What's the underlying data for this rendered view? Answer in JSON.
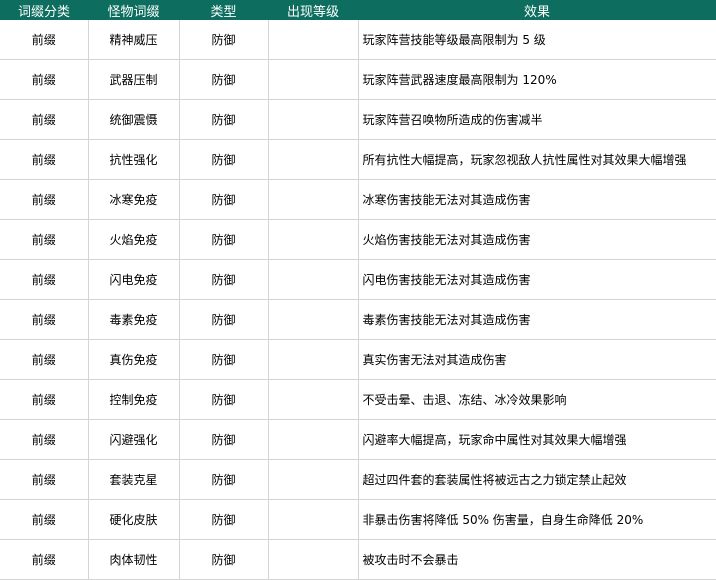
{
  "header": {
    "colors": {
      "header_bg": "#0d6e5f"
    },
    "columns": [
      "词缀分类",
      "怪物词缀",
      "类型",
      "出现等级",
      "效果"
    ]
  },
  "rows": [
    {
      "category": "前缀",
      "name": "精神威压",
      "type": "防御",
      "level": "",
      "effect": "玩家阵营技能等级最高限制为 5 级"
    },
    {
      "category": "前缀",
      "name": "武器压制",
      "type": "防御",
      "level": "",
      "effect": "玩家阵营武器速度最高限制为 120%"
    },
    {
      "category": "前缀",
      "name": "统御震慑",
      "type": "防御",
      "level": "",
      "effect": "玩家阵营召唤物所造成的伤害减半"
    },
    {
      "category": "前缀",
      "name": "抗性强化",
      "type": "防御",
      "level": "",
      "effect": "所有抗性大幅提高，玩家忽视敌人抗性属性对其效果大幅增强"
    },
    {
      "category": "前缀",
      "name": "冰寒免疫",
      "type": "防御",
      "level": "",
      "effect": "冰寒伤害技能无法对其造成伤害"
    },
    {
      "category": "前缀",
      "name": "火焰免疫",
      "type": "防御",
      "level": "",
      "effect": "火焰伤害技能无法对其造成伤害"
    },
    {
      "category": "前缀",
      "name": "闪电免疫",
      "type": "防御",
      "level": "",
      "effect": "闪电伤害技能无法对其造成伤害"
    },
    {
      "category": "前缀",
      "name": "毒素免疫",
      "type": "防御",
      "level": "",
      "effect": "毒素伤害技能无法对其造成伤害"
    },
    {
      "category": "前缀",
      "name": "真伤免疫",
      "type": "防御",
      "level": "",
      "effect": "真实伤害无法对其造成伤害"
    },
    {
      "category": "前缀",
      "name": "控制免疫",
      "type": "防御",
      "level": "",
      "effect": "不受击晕、击退、冻结、冰冷效果影响"
    },
    {
      "category": "前缀",
      "name": "闪避强化",
      "type": "防御",
      "level": "",
      "effect": "闪避率大幅提高，玩家命中属性对其效果大幅增强"
    },
    {
      "category": "前缀",
      "name": "套装克星",
      "type": "防御",
      "level": "",
      "effect": "超过四件套的套装属性将被远古之力锁定禁止起效"
    },
    {
      "category": "前缀",
      "name": "硬化皮肤",
      "type": "防御",
      "level": "",
      "effect": "非暴击伤害将降低 50% 伤害量，自身生命降低 20%"
    },
    {
      "category": "前缀",
      "name": "肉体韧性",
      "type": "防御",
      "level": "",
      "effect": "被攻击时不会暴击"
    }
  ]
}
